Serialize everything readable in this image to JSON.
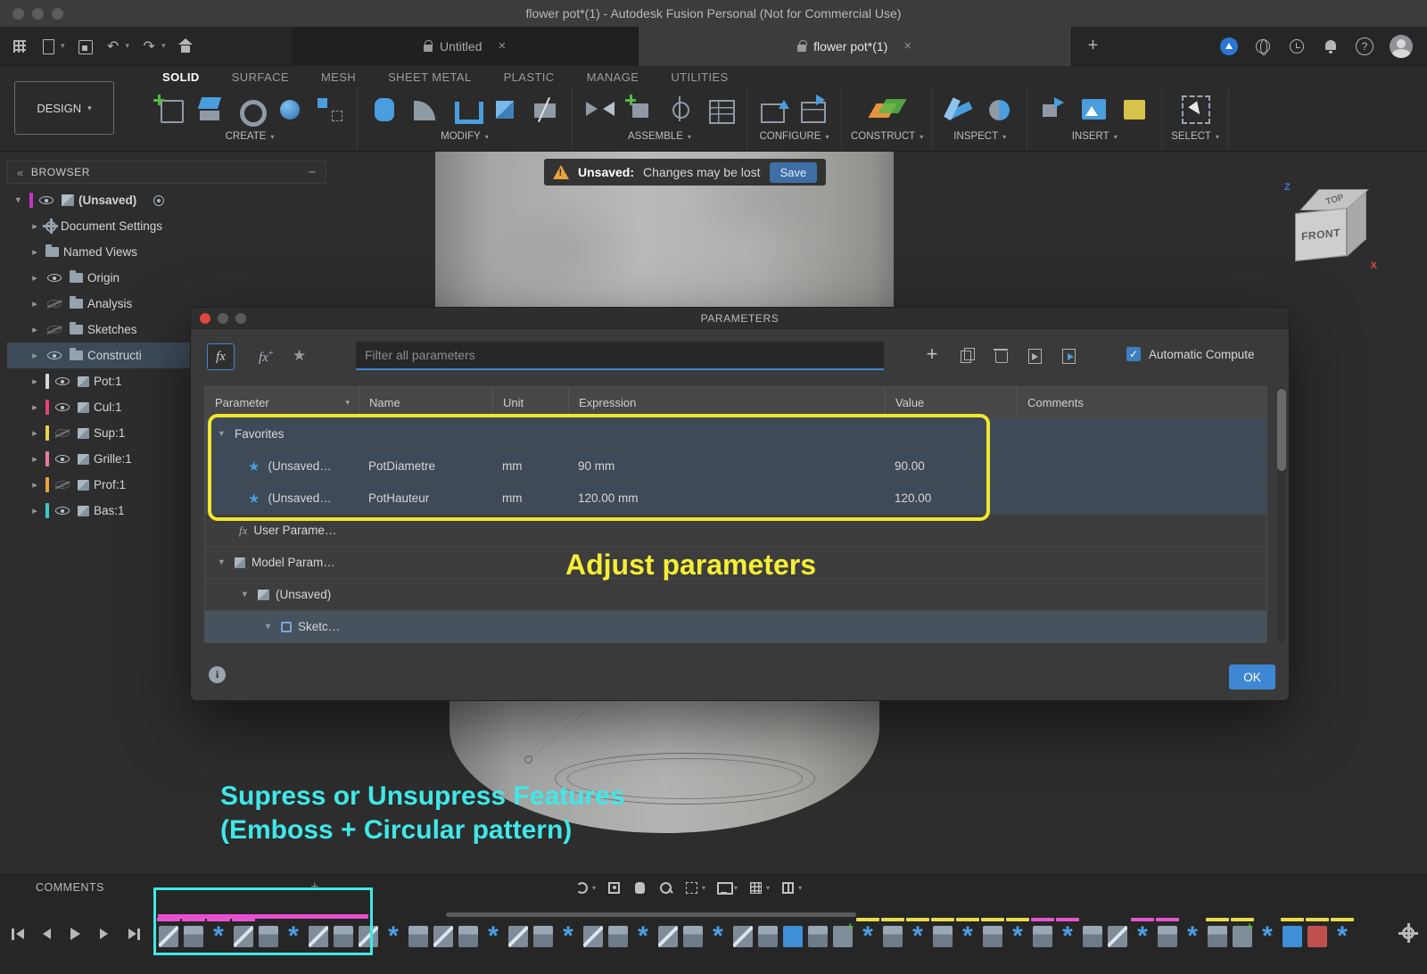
{
  "titlebar": {
    "title": "flower pot*(1) - Autodesk Fusion Personal (Not for Commercial Use)"
  },
  "tabbar": {
    "tabs": [
      {
        "label": "Untitled"
      },
      {
        "label": "flower pot*(1)"
      }
    ]
  },
  "ribbon": {
    "design_label": "DESIGN",
    "tabs": [
      "SOLID",
      "SURFACE",
      "MESH",
      "SHEET METAL",
      "PLASTIC",
      "MANAGE",
      "UTILITIES"
    ],
    "groups": [
      {
        "label": "CREATE",
        "icons": [
          "create-sketch-icon",
          "extrude-icon",
          "revolve-icon",
          "sphere-icon",
          "rectangular-pattern-icon"
        ]
      },
      {
        "label": "MODIFY",
        "icons": [
          "press-pull-icon",
          "fillet-icon",
          "shell-icon",
          "combine-icon",
          "split-body-icon"
        ]
      },
      {
        "label": "ASSEMBLE",
        "icons": [
          "joint-icon",
          "new-component-icon",
          "joint-origin-icon",
          "bom-icon"
        ]
      },
      {
        "label": "CONFIGURE",
        "icons": [
          "configuration-icon",
          "configuration-table-icon"
        ]
      },
      {
        "label": "CONSTRUCT",
        "icons": [
          "construction-plane-icon"
        ]
      },
      {
        "label": "INSPECT",
        "icons": [
          "measure-icon",
          "section-analysis-icon"
        ]
      },
      {
        "label": "INSERT",
        "icons": [
          "insert-derive-icon",
          "canvas-icon",
          "insert-mcmaster-icon"
        ]
      },
      {
        "label": "SELECT",
        "icons": [
          "select-icon"
        ]
      }
    ]
  },
  "banner": {
    "label": "Unsaved:",
    "message": "Changes may be lost",
    "save_label": "Save"
  },
  "browser": {
    "title": "BROWSER",
    "items": [
      {
        "label": "(Unsaved)",
        "icon": "component",
        "vis": "on",
        "chevron": "down",
        "bold": true,
        "indent": 0,
        "bar": "#c535c5",
        "target": true
      },
      {
        "label": "Document Settings",
        "icon": "gear",
        "vis": "none",
        "chevron": "right",
        "indent": 1
      },
      {
        "label": "Named Views",
        "icon": "folder",
        "vis": "none",
        "chevron": "right",
        "indent": 1
      },
      {
        "label": "Origin",
        "icon": "folder",
        "vis": "on",
        "chevron": "right",
        "indent": 1
      },
      {
        "label": "Analysis",
        "icon": "folder",
        "vis": "off",
        "chevron": "right",
        "indent": 1
      },
      {
        "label": "Sketches",
        "icon": "folder",
        "vis": "off",
        "chevron": "right",
        "indent": 1
      },
      {
        "label": "Constructi",
        "icon": "folder",
        "vis": "on",
        "chevron": "right",
        "indent": 1,
        "selected": true
      },
      {
        "label": "Pot:1",
        "icon": "body",
        "vis": "on",
        "chevron": "right",
        "indent": 1,
        "bar": "#d9d9d9"
      },
      {
        "label": "Cul:1",
        "icon": "body",
        "vis": "on",
        "chevron": "right",
        "indent": 1,
        "bar": "#e8417a"
      },
      {
        "label": "Sup:1",
        "icon": "body",
        "vis": "off",
        "chevron": "right",
        "indent": 1,
        "bar": "#e8d44d"
      },
      {
        "label": "Grille:1",
        "icon": "body",
        "vis": "on",
        "chevron": "right",
        "indent": 1,
        "bar": "#e87aa0"
      },
      {
        "label": "Prof:1",
        "icon": "body",
        "vis": "off",
        "chevron": "right",
        "indent": 1,
        "bar": "#e8a23f"
      },
      {
        "label": "Bas:1",
        "icon": "body",
        "vis": "on",
        "chevron": "right",
        "indent": 1,
        "bar": "#3fc8c8"
      }
    ]
  },
  "viewcube": {
    "top_label": "TOP",
    "front_label": "FRONT",
    "x_label": "X",
    "z_label": "Z"
  },
  "dialog": {
    "title": "PARAMETERS",
    "filter_placeholder": "Filter all parameters",
    "auto_compute_label": "Automatic Compute",
    "columns": [
      "Parameter",
      "Name",
      "Unit",
      "Expression",
      "Value",
      "Comments"
    ],
    "rows": [
      {
        "kind": "section",
        "label": "Favorites",
        "indent": 0,
        "chevron": true,
        "selected": true
      },
      {
        "kind": "param",
        "parameter": "(Unsaved…",
        "name": "PotDiametre",
        "unit": "mm",
        "expression": "90 mm",
        "value": "90.00",
        "comments": "",
        "selected": true
      },
      {
        "kind": "param",
        "parameter": "(Unsaved…",
        "name": "PotHauteur",
        "unit": "mm",
        "expression": "120.00 mm",
        "value": "120.00",
        "comments": "",
        "selected": true
      },
      {
        "kind": "section-fx",
        "label": "User Parame…",
        "indent": 1
      },
      {
        "kind": "section-model",
        "label": "Model Param…",
        "indent": 0,
        "chevron": true
      },
      {
        "kind": "sub",
        "label": "(Unsaved)",
        "indent": 1,
        "chevron": true
      },
      {
        "kind": "sub-sketch",
        "label": "Sketc…",
        "indent": 2,
        "chevron": true,
        "selected": true
      }
    ],
    "ok_label": "OK"
  },
  "annotations": {
    "adjust": "Adjust parameters",
    "suppress_line1": "Supress or Unsupress Features",
    "suppress_line2": "(Emboss + Circular pattern)"
  },
  "comments": {
    "title": "COMMENTS"
  },
  "playback": {
    "buttons": [
      "go-to-start",
      "step-back",
      "play",
      "step-forward",
      "go-to-end"
    ]
  },
  "navbar": {
    "icons": [
      {
        "name": "orbit-icon",
        "caret": true
      },
      {
        "name": "look-at-icon",
        "caret": false
      },
      {
        "name": "pan-icon",
        "caret": false
      },
      {
        "name": "zoom-icon",
        "caret": false
      },
      {
        "name": "fit-icon",
        "caret": true
      },
      {
        "name": "display-settings-icon",
        "caret": true
      },
      {
        "name": "grid-settings-icon",
        "caret": true
      },
      {
        "name": "viewports-icon",
        "caret": true
      }
    ]
  },
  "timeline": {
    "icons": [
      {
        "t": "sketch",
        "m": "magenta"
      },
      {
        "t": "feature",
        "m": "magenta"
      },
      {
        "t": "pattern",
        "m": "magenta"
      },
      {
        "t": "sketch",
        "m": "magenta"
      },
      {
        "t": "feature",
        "m": "none"
      },
      {
        "t": "pattern",
        "m": "none"
      },
      {
        "t": "sketch",
        "m": "none"
      },
      {
        "t": "feature",
        "m": "none"
      },
      {
        "t": "sketch",
        "m": "none"
      },
      {
        "t": "pattern",
        "m": "none"
      },
      {
        "t": "feature",
        "m": "none"
      },
      {
        "t": "sketch",
        "m": "none"
      },
      {
        "t": "feature",
        "m": "none"
      },
      {
        "t": "pattern",
        "m": "none"
      },
      {
        "t": "sketch",
        "m": "none"
      },
      {
        "t": "feature",
        "m": "none"
      },
      {
        "t": "pattern",
        "m": "none"
      },
      {
        "t": "sketch",
        "m": "none"
      },
      {
        "t": "feature",
        "m": "none"
      },
      {
        "t": "pattern",
        "m": "none"
      },
      {
        "t": "sketch",
        "m": "none"
      },
      {
        "t": "feature",
        "m": "none"
      },
      {
        "t": "pattern",
        "m": "none"
      },
      {
        "t": "sketch",
        "m": "none"
      },
      {
        "t": "feature",
        "m": "none"
      },
      {
        "t": "special",
        "m": "none"
      },
      {
        "t": "feature",
        "m": "none"
      },
      {
        "t": "component",
        "m": "none"
      },
      {
        "t": "pattern",
        "m": "yellow"
      },
      {
        "t": "feature",
        "m": "yellow"
      },
      {
        "t": "pattern",
        "m": "yellow"
      },
      {
        "t": "feature",
        "m": "yellow"
      },
      {
        "t": "pattern",
        "m": "yellow"
      },
      {
        "t": "feature",
        "m": "yellow"
      },
      {
        "t": "pattern",
        "m": "yellow"
      },
      {
        "t": "feature",
        "m": "magenta"
      },
      {
        "t": "pattern",
        "m": "magenta"
      },
      {
        "t": "feature",
        "m": "none"
      },
      {
        "t": "sketch",
        "m": "none"
      },
      {
        "t": "pattern",
        "m": "magenta"
      },
      {
        "t": "feature",
        "m": "magenta"
      },
      {
        "t": "pattern",
        "m": "none"
      },
      {
        "t": "feature",
        "m": "yellow"
      },
      {
        "t": "component",
        "m": "yellow"
      },
      {
        "t": "pattern",
        "m": "none"
      },
      {
        "t": "special",
        "m": "yellow"
      },
      {
        "t": "redbox",
        "m": "yellow"
      },
      {
        "t": "pattern",
        "m": "yellow"
      }
    ]
  }
}
